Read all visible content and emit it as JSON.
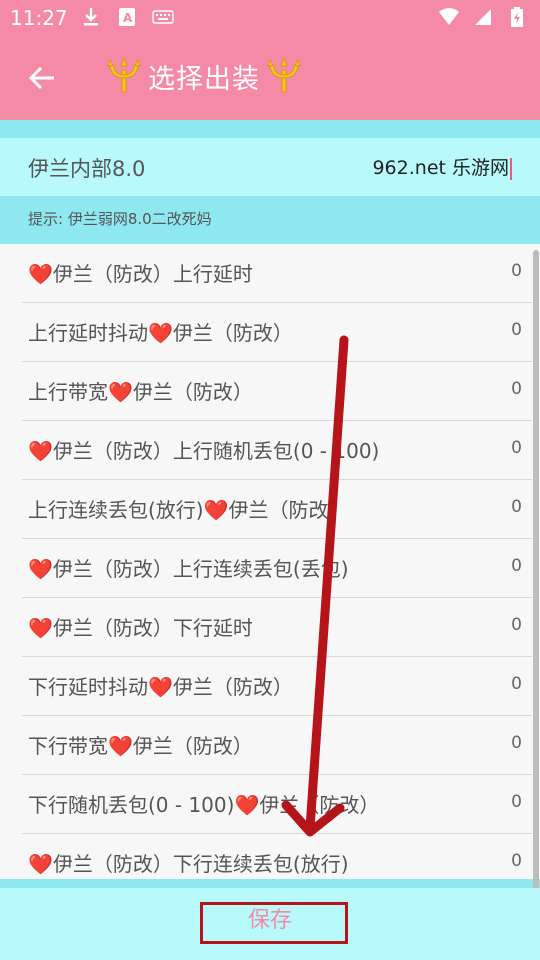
{
  "status_bar": {
    "time": "11:27",
    "icons_left": [
      "download-icon",
      "a-badge-icon",
      "keyboard-icon"
    ],
    "icons_right": [
      "wifi-icon",
      "signal-icon",
      "battery-icon"
    ]
  },
  "app_bar": {
    "title": "选择出装",
    "back_icon": "arrow-left-icon",
    "title_decoration_icon": "trident-icon",
    "background": "#f48aa6"
  },
  "header": {
    "config_name": "伊兰内部8.0",
    "watermark": "962.net 乐游网"
  },
  "hint": "提示: 伊兰弱网8.0二改死妈",
  "heart_symbol": "❤️",
  "list_items": [
    {
      "pre": "",
      "post": "伊兰（防改）上行延时",
      "value": "0"
    },
    {
      "pre": "上行延时抖动",
      "post": "伊兰（防改）",
      "value": "0"
    },
    {
      "pre": "上行带宽",
      "post": "伊兰（防改）",
      "value": "0"
    },
    {
      "pre": "",
      "post": "伊兰（防改）上行随机丢包(0 - 100)",
      "value": "0"
    },
    {
      "pre": "上行连续丢包(放行)",
      "post": "伊兰（防改）",
      "value": "0"
    },
    {
      "pre": "",
      "post": "伊兰（防改）上行连续丢包(丢包)",
      "value": "0"
    },
    {
      "pre": "",
      "post": "伊兰（防改）下行延时",
      "value": "0"
    },
    {
      "pre": "下行延时抖动",
      "post": "伊兰（防改）",
      "value": "0"
    },
    {
      "pre": "下行带宽",
      "post": "伊兰（防改）",
      "value": "0"
    },
    {
      "pre": "下行随机丢包(0 - 100)",
      "post": "伊兰（防改）",
      "value": "0"
    },
    {
      "pre": "",
      "post": "伊兰（防改）下行连续丢包(放行)",
      "value": "0"
    }
  ],
  "save_label": "保存",
  "colors": {
    "accent_pink": "#f48aa6",
    "panel_cyan": "#8ee8f0",
    "light_cyan": "#b8fafb",
    "annotation_red": "#b5141a"
  }
}
